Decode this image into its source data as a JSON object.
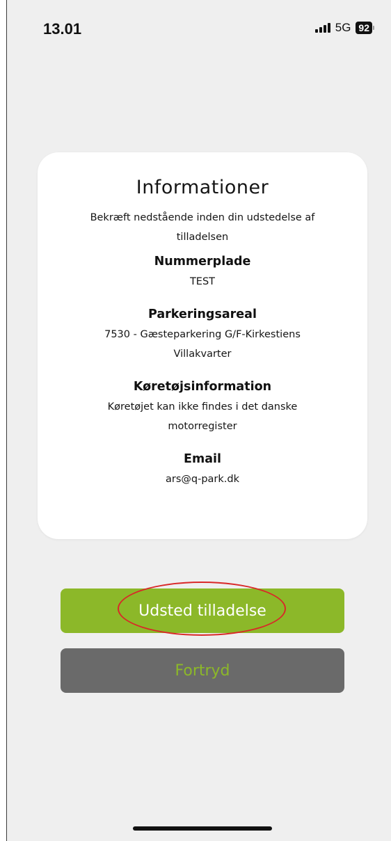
{
  "status_bar": {
    "time": "13.01",
    "network": "5G",
    "battery": "92",
    "icons": [
      "signal-icon",
      "battery-icon"
    ]
  },
  "card": {
    "title": "Informationer",
    "intro": "Bekræft nedstående inden din udstedelse af tilladelsen",
    "fields": [
      {
        "label": "Nummerplade",
        "value": "TEST"
      },
      {
        "label": "Parkeringsareal",
        "value": "7530 - Gæsteparkering G/F-Kirkestiens Villakvarter"
      },
      {
        "label": "Køretøjsinformation",
        "value": "Køretøjet kan ikke findes i det danske motorregister"
      },
      {
        "label": "Email",
        "value": "ars@q-park.dk"
      }
    ]
  },
  "actions": {
    "issue_label": "Udsted tilladelse",
    "cancel_label": "Fortryd"
  },
  "colors": {
    "background": "#efefef",
    "card": "#ffffff",
    "primary_button": "#8cb829",
    "secondary_button": "#6a6a6a",
    "secondary_text": "#8cb829",
    "annotation": "#d92828"
  }
}
